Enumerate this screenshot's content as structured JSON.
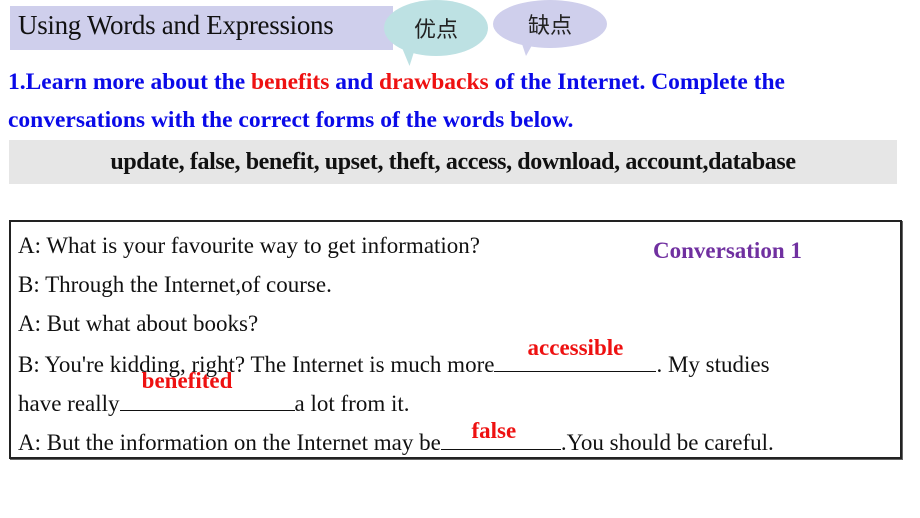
{
  "header": {
    "title": "Using Words and Expressions",
    "bubbles": [
      {
        "label": "优点",
        "meaning": "advantages"
      },
      {
        "label": "缺点",
        "meaning": "disadvantages"
      }
    ]
  },
  "instructions": {
    "part1": "1.Learn more about the ",
    "highlight1": "benefits",
    "part2": " and ",
    "highlight2": "drawbacks",
    "part3": " of the Internet. Complete the conversations with the correct forms of the words below."
  },
  "word_bank": {
    "text": "update, false, benefit, upset, theft, access, download, account,database"
  },
  "conversation": {
    "title": "Conversation 1",
    "lines": [
      {
        "text": "A: What is your favourite way to get information?"
      },
      {
        "text": "B: Through the Internet,of course."
      },
      {
        "text": "A: But what about books?"
      },
      {
        "before": "B: You're kidding, right? The Internet is much more",
        "answer": "accessible",
        "after": ". My studies"
      },
      {
        "before": "have really",
        "answer": "benefited",
        "after": "a lot from it."
      },
      {
        "before": "A: But the information on the Internet may be",
        "answer": "false",
        "after": ".You should be careful."
      }
    ]
  },
  "colors": {
    "instruction_blue": "#0a0ae8",
    "highlight_red": "#ee1111",
    "conversation_title_purple": "#7030a0",
    "title_bar_lavender": "#cfcfec",
    "bubble_teal": "#bde1e3",
    "word_bank_gray": "#e6e6e6"
  }
}
